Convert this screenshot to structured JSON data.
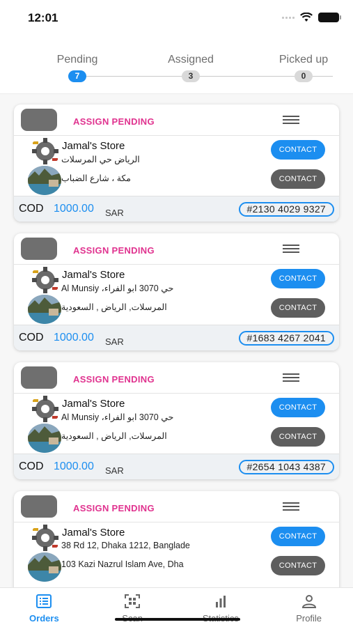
{
  "status_bar": {
    "time": "12:01"
  },
  "steps": [
    {
      "label": "Pending",
      "count": "7",
      "active": true
    },
    {
      "label": "Assigned",
      "count": "3",
      "active": false
    },
    {
      "label": "Picked up",
      "count": "0",
      "active": false
    }
  ],
  "orders": [
    {
      "status": "ASSIGN PENDING",
      "store_name": "Jamal's Store",
      "pickup_address": "الرياض حي المرسلات",
      "dropoff_address": "مكة ، شارع الضباب",
      "contact_pickup_label": "CONTACT",
      "contact_dropoff_label": "CONTACT",
      "cod_label": "COD",
      "cod_amount": "1000.00",
      "currency": "SAR",
      "tracking": "#2130 4029 9327"
    },
    {
      "status": "ASSIGN PENDING",
      "store_name": "Jamal's Store",
      "pickup_address": "Al Munsiy ،حي 3070 ابو الفراء",
      "dropoff_address": "المرسلات, الرياض , السعودية",
      "contact_pickup_label": "CONTACT",
      "contact_dropoff_label": "CONTACT",
      "cod_label": "COD",
      "cod_amount": "1000.00",
      "currency": "SAR",
      "tracking": "#1683 4267 2041"
    },
    {
      "status": "ASSIGN PENDING",
      "store_name": "Jamal's Store",
      "pickup_address": "Al Munsiy ،حي 3070 ابو الفراء",
      "dropoff_address": "المرسلات, الرياض , السعودية",
      "contact_pickup_label": "CONTACT",
      "contact_dropoff_label": "CONTACT",
      "cod_label": "COD",
      "cod_amount": "1000.00",
      "currency": "SAR",
      "tracking": "#2654 1043 4387"
    },
    {
      "status": "ASSIGN PENDING",
      "store_name": "Jamal's Store",
      "pickup_address": "38 Rd 12, Dhaka 1212, Banglade",
      "dropoff_address": "103 Kazi Nazrul Islam Ave, Dha",
      "contact_pickup_label": "CONTACT",
      "contact_dropoff_label": "CONTACT",
      "cod_label": "",
      "cod_amount": "",
      "currency": "",
      "tracking": ""
    }
  ],
  "tabs": [
    {
      "label": "Orders",
      "icon": "orders-icon",
      "active": true
    },
    {
      "label": "Scan",
      "icon": "qr-scan-icon",
      "active": false
    },
    {
      "label": "Statistics",
      "icon": "statistics-icon",
      "active": false
    },
    {
      "label": "Profile",
      "icon": "profile-icon",
      "active": false
    }
  ],
  "colors": {
    "accent": "#1c8ef0",
    "status_pink": "#e0338f",
    "button_gray": "#5e5e5e"
  }
}
